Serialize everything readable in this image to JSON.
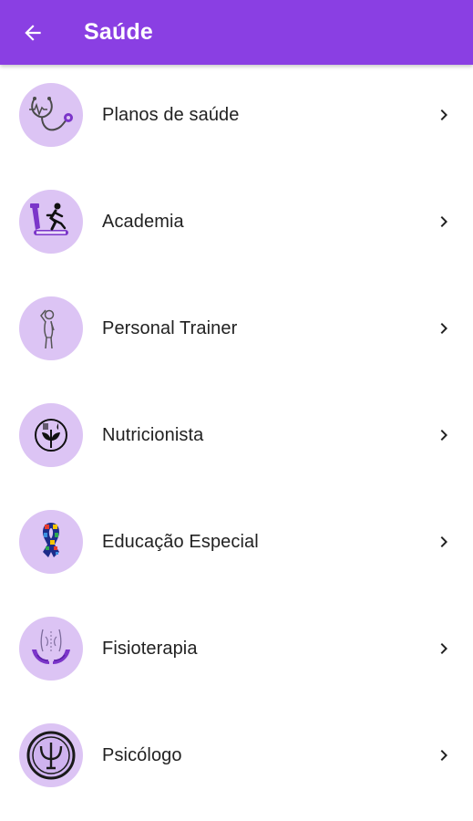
{
  "appbar": {
    "title": "Saúde",
    "back_icon": "arrow-left-icon",
    "color": "#8a3fe3"
  },
  "colors": {
    "avatar_bg": "#dcc4f4",
    "icon_purple": "#7b35c9"
  },
  "items": [
    {
      "label": "Planos de saúde",
      "icon": "stethoscope-icon"
    },
    {
      "label": "Academia",
      "icon": "treadmill-icon"
    },
    {
      "label": "Personal Trainer",
      "icon": "person-stretching-icon"
    },
    {
      "label": "Nutricionista",
      "icon": "fork-knife-leaf-icon"
    },
    {
      "label": "Educação Especial",
      "icon": "puzzle-ribbon-icon"
    },
    {
      "label": "Fisioterapia",
      "icon": "back-hands-icon"
    },
    {
      "label": "Psicólogo",
      "icon": "psi-icon"
    }
  ]
}
